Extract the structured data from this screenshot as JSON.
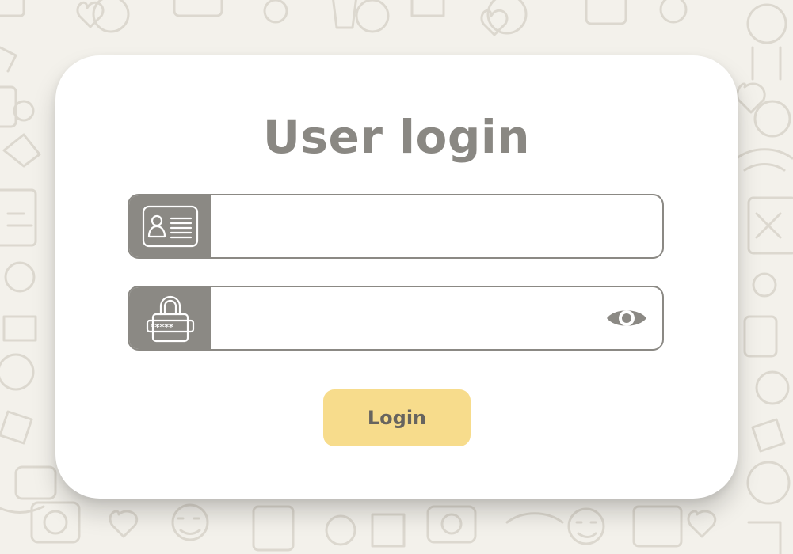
{
  "page": {
    "title": "User login"
  },
  "form": {
    "username": {
      "value": "",
      "placeholder": "",
      "icon": "id-card-icon"
    },
    "password": {
      "value": "",
      "placeholder": "",
      "icon": "padlock-icon",
      "toggle_icon": "eye-icon"
    },
    "login_label": "Login"
  },
  "colors": {
    "background": "#f3f1eb",
    "card": "#ffffff",
    "title": "#8a8883",
    "field_border": "#8b8984",
    "icon_box": "#8b8984",
    "button": "#f7dc8c",
    "button_text": "#67645f"
  }
}
